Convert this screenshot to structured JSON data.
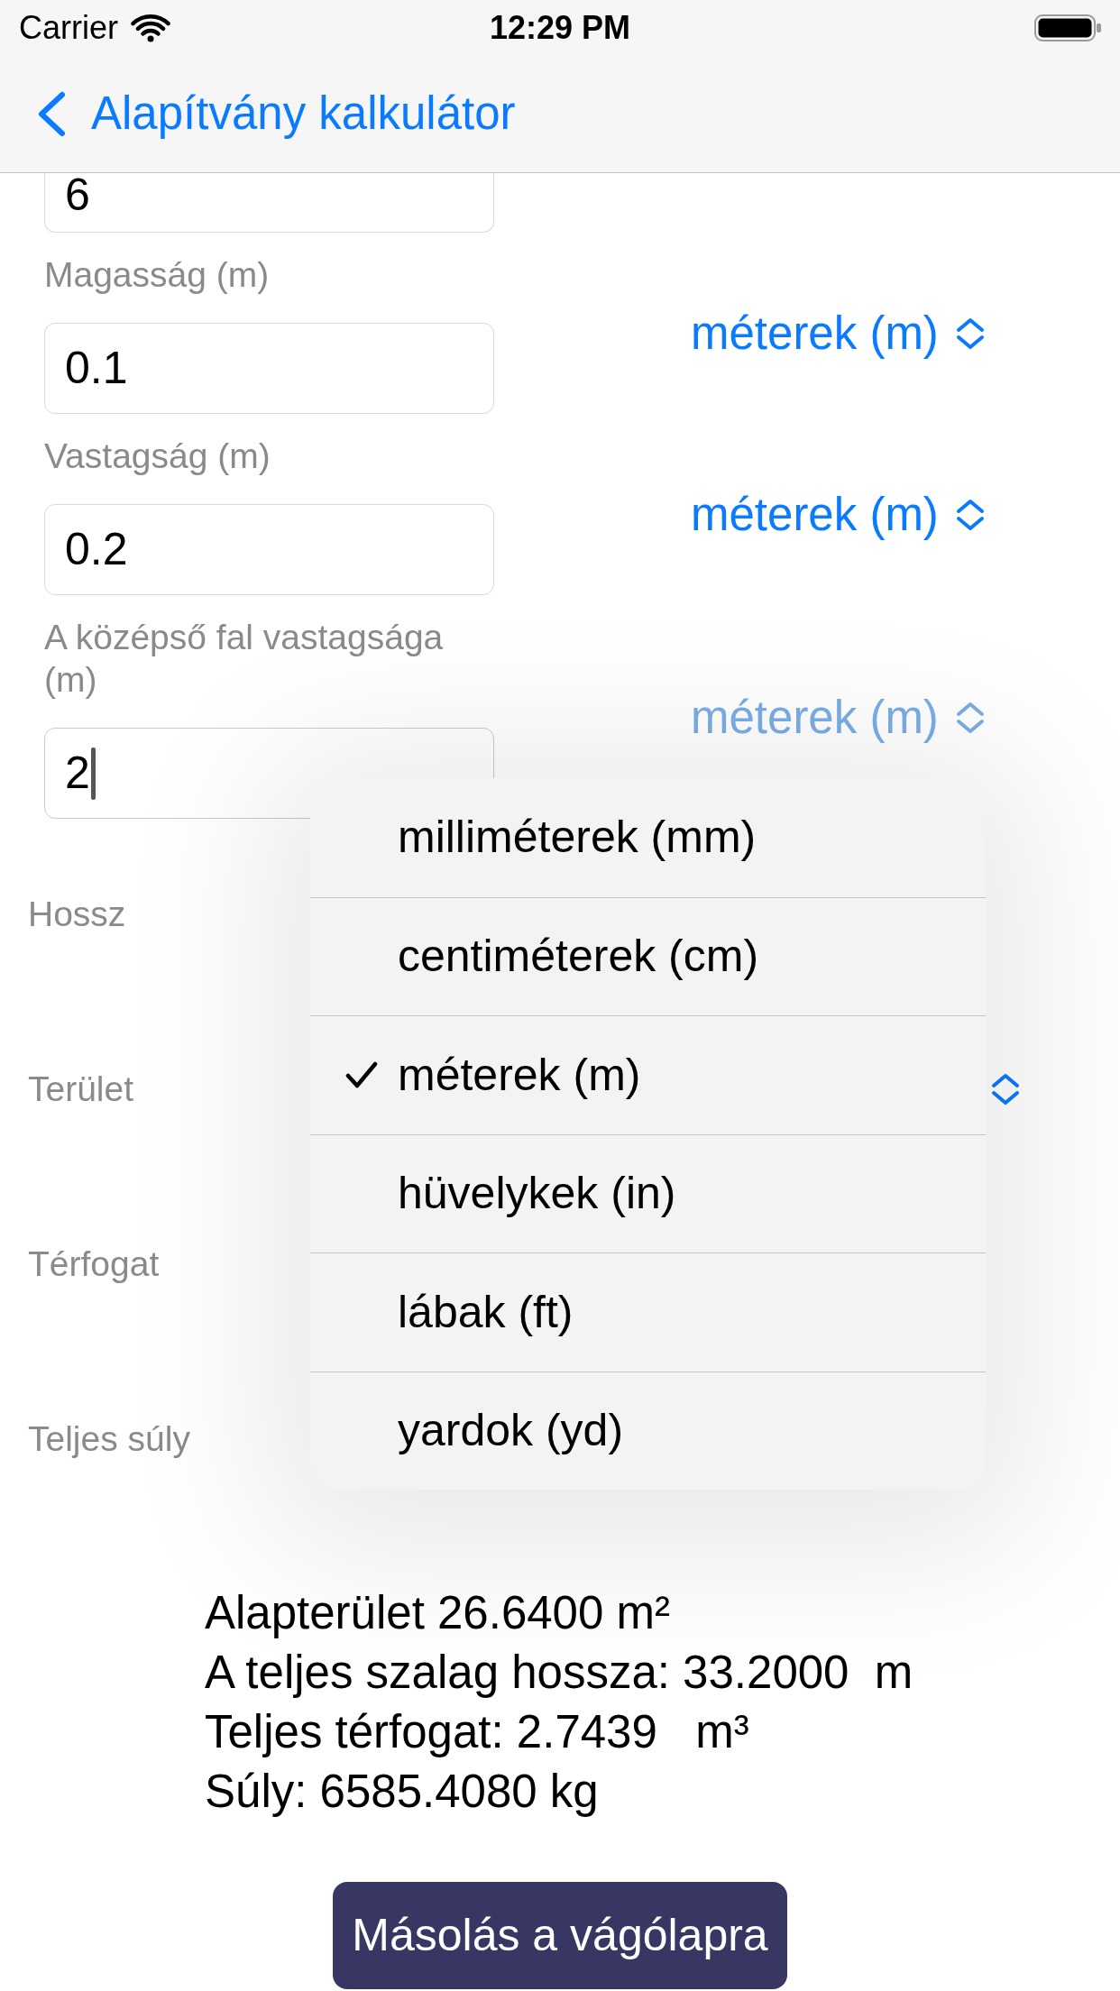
{
  "status_bar": {
    "carrier": "Carrier",
    "time": "12:29 PM"
  },
  "nav_bar": {
    "back_title": "Alapítvány kalkulátor"
  },
  "inputs": [
    {
      "value": "6",
      "focused": false
    },
    {
      "label": "Magasság (m)",
      "value": "0.1",
      "focused": false,
      "unit": {
        "label": "méterek (m)",
        "open": false
      }
    },
    {
      "label": "Vastagság (m)",
      "value": "0.2",
      "focused": false,
      "unit": {
        "label": "méterek (m)",
        "open": false
      }
    },
    {
      "label": "A középső fal vastagsága (m)",
      "value": "2",
      "focused": true,
      "unit": {
        "label": "méterek (m)",
        "open": true
      }
    }
  ],
  "output_rows": [
    {
      "label": "Hossz",
      "kind": "plain"
    },
    {
      "label": "Terület",
      "kind": "picker"
    },
    {
      "label": "Térfogat",
      "kind": "plain"
    },
    {
      "label": "Teljes súly",
      "kind": "plain"
    }
  ],
  "results": [
    "Alapterület 26.6400 m²",
    "A teljes szalag hossza: 33.2000  m",
    "Teljes térfogat: 2.7439   m³",
    "Súly: 6585.4080 kg"
  ],
  "copy_button": "Másolás a vágólapra",
  "unit_menu": {
    "items": [
      {
        "label": "milliméterek (mm)",
        "selected": false
      },
      {
        "label": "centiméterek (cm)",
        "selected": false
      },
      {
        "label": "méterek (m)",
        "selected": true
      },
      {
        "label": "hüvelykek (in)",
        "selected": false
      },
      {
        "label": "lábak (ft)",
        "selected": false
      },
      {
        "label": "yardok (yd)",
        "selected": false
      }
    ]
  }
}
